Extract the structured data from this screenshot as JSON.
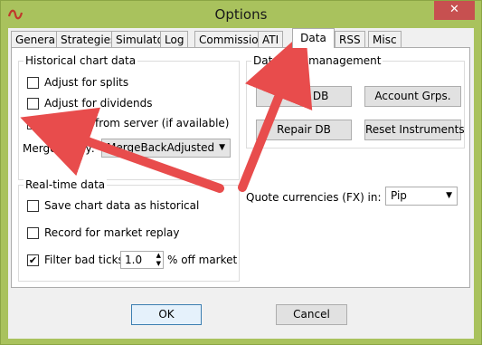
{
  "window": {
    "title": "Options",
    "close_glyph": "✕"
  },
  "tabs": [
    "General",
    "Strategies",
    "Simulator",
    "Log",
    "Commission",
    "ATI",
    "Data",
    "RSS",
    "Misc"
  ],
  "active_tab": "Data",
  "historical": {
    "title": "Historical chart data",
    "adjust_splits": {
      "label": "Adjust for splits",
      "checked": false
    },
    "adjust_dividends": {
      "label": "Adjust for dividends",
      "checked": false
    },
    "get_from_server": {
      "label": "Get data from server (if available)",
      "checked": true
    },
    "merge_label": "Merge policy:",
    "merge_value": "MergeBackAdjusted"
  },
  "realtime": {
    "title": "Real-time data",
    "save_chart": {
      "label": "Save chart data as historical",
      "checked": false
    },
    "record_replay": {
      "label": "Record for market replay",
      "checked": false
    },
    "filter_bad": {
      "label": "Filter bad ticks",
      "checked": true
    },
    "filter_value": "1.0",
    "off_market_label": "% off market"
  },
  "db": {
    "title": "Database management",
    "reset_db": "Reset DB",
    "account_grps": "Account Grps.",
    "repair_db": "Repair DB",
    "reset_instruments": "Reset Instruments"
  },
  "quote": {
    "label": "Quote currencies (FX) in:",
    "value": "Pip"
  },
  "buttons": {
    "ok": "OK",
    "cancel": "Cancel"
  },
  "colors": {
    "annotation_arrow": "#E84C4C",
    "title_bar": "#A9C25D",
    "close": "#C75050"
  },
  "icons": {
    "app": "ninja-logo-icon",
    "check": "✔",
    "dropdown": "▼",
    "spin_up": "▲",
    "spin_down": "▼"
  }
}
